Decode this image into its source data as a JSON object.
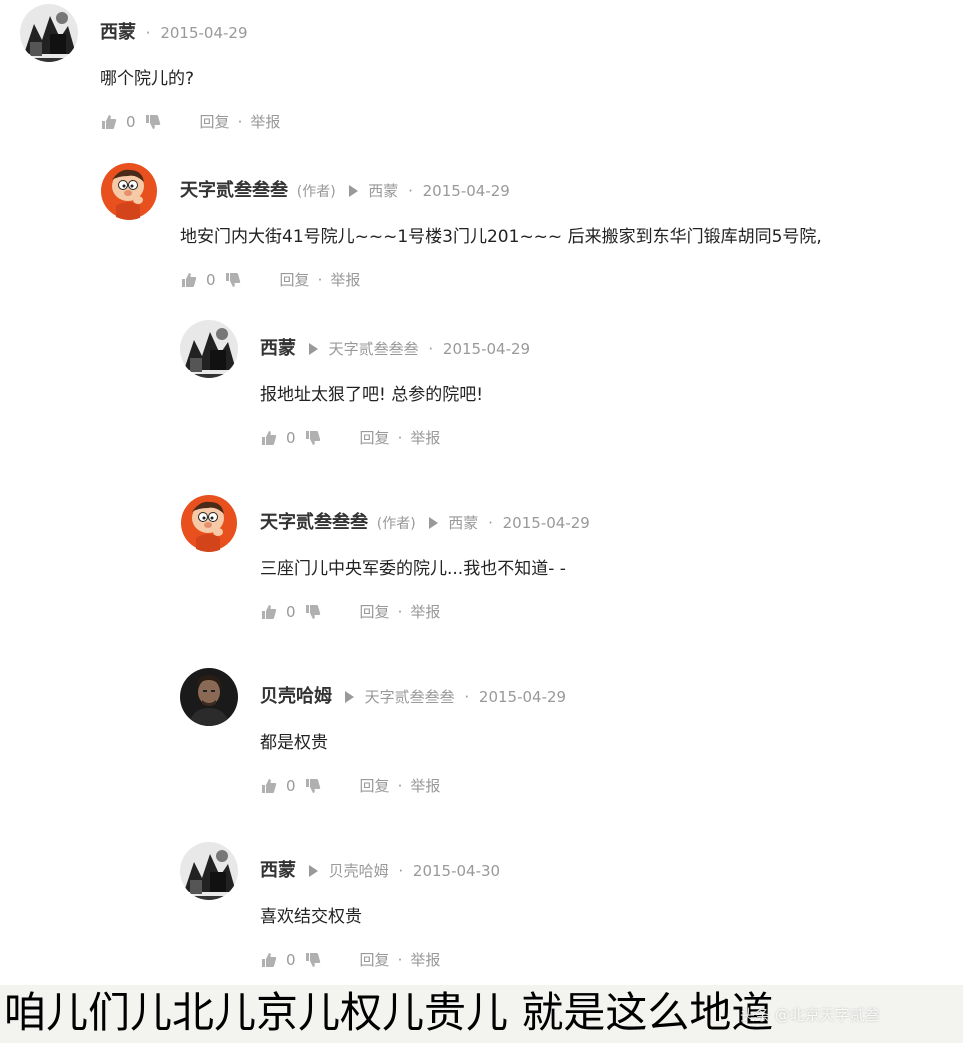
{
  "comments": [
    {
      "author": "西蒙",
      "author_tag": "",
      "reply_to": "",
      "date": "2015-04-29",
      "text": "哪个院儿的?",
      "likes": "0",
      "avatar": "bw-photo-avatar",
      "reply_label": "回复",
      "sep": "·",
      "report_label": "举报"
    },
    {
      "author": "天字贰叁叁叁",
      "author_tag": "(作者)",
      "reply_to": "西蒙",
      "date": "2015-04-29",
      "text": "地安门内大街41号院儿~~~1号楼3门儿201~~~ 后来搬家到东华门锻库胡同5号院,",
      "likes": "0",
      "avatar": "cartoon-avatar",
      "reply_label": "回复",
      "sep": "·",
      "report_label": "举报"
    },
    {
      "author": "西蒙",
      "author_tag": "",
      "reply_to": "天字贰叁叁叁",
      "date": "2015-04-29",
      "text": "报地址太狠了吧! 总参的院吧!",
      "likes": "0",
      "avatar": "bw-photo-avatar",
      "reply_label": "回复",
      "sep": "·",
      "report_label": "举报"
    },
    {
      "author": "天字贰叁叁叁",
      "author_tag": "(作者)",
      "reply_to": "西蒙",
      "date": "2015-04-29",
      "text": "三座门儿中央军委的院儿...我也不知道- -",
      "likes": "0",
      "avatar": "cartoon-avatar",
      "reply_label": "回复",
      "sep": "·",
      "report_label": "举报"
    },
    {
      "author": "贝壳哈姆",
      "author_tag": "",
      "reply_to": "天字贰叁叁叁",
      "date": "2015-04-29",
      "text": "都是权贵",
      "likes": "0",
      "avatar": "dark-portrait-avatar",
      "reply_label": "回复",
      "sep": "·",
      "report_label": "举报"
    },
    {
      "author": "西蒙",
      "author_tag": "",
      "reply_to": "贝壳哈姆",
      "date": "2015-04-30",
      "text": "喜欢结交权贵",
      "likes": "0",
      "avatar": "bw-photo-avatar",
      "reply_label": "回复",
      "sep": "·",
      "report_label": "举报"
    }
  ],
  "caption": "咱儿们儿北儿京儿权儿贵儿 就是这么地道",
  "watermark": "头条 @北京天字贰叁",
  "colors": {
    "meta_gray": "#999999",
    "text": "#222222",
    "author": "#333333",
    "caption_bg": "#f3f3f0"
  },
  "icons": {
    "like": "thumbs-up-icon",
    "dislike": "thumbs-down-icon",
    "reply_arrow": "reply-to-arrow-icon"
  }
}
